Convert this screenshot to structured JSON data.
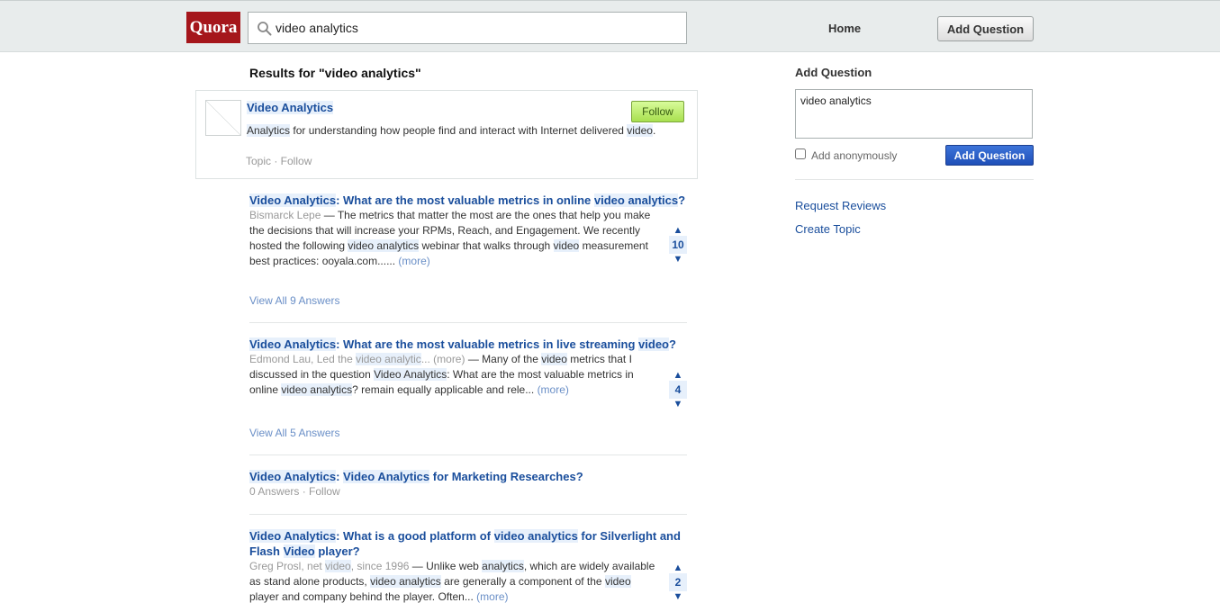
{
  "header": {
    "logo": "Quora",
    "search_value": "video analytics",
    "nav_home": "Home",
    "add_question_label": "Add Question"
  },
  "results": {
    "title": "Results for \"video analytics\""
  },
  "topic": {
    "title": "Video Analytics",
    "follow_label": "Follow",
    "desc_1": "Analytics",
    "desc_2": " for understanding how people find and interact with Internet delivered ",
    "desc_3": "video",
    "desc_4": ".",
    "meta": "Topic · Follow"
  },
  "questions": [
    {
      "title_hl": "Video Analytics",
      "title_rest_1": ": What are the most valuable metrics in online ",
      "title_hl_2": "video analytics",
      "title_rest_2": "?",
      "author": "Bismarck Lepe",
      "text_1": " — The metrics that matter the most are the ones that help you make the decisions that will increase your RPMs, Reach, and Engagement. We recently hosted the following ",
      "text_hl_1": "video analytics",
      "text_2": " webinar that walks through ",
      "text_hl_2": "video",
      "text_3": " measurement best practices: ooyala.com...... ",
      "more": "(more)",
      "votes": "10",
      "view_all": "View All 9 Answers"
    },
    {
      "title_hl": "Video Analytics",
      "title_rest_1": ": What are the most valuable metrics in live streaming ",
      "title_hl_2": "video",
      "title_rest_2": "?",
      "author": "Edmond Lau, Led the ",
      "author_hl": "video analytic",
      "author_tail": "... (more) ",
      "text_1": " — Many of the ",
      "text_hl_1": "video",
      "text_2": " metrics that I discussed in the question ",
      "text_hl_2": "Video Analytics",
      "text_3": ": What are the most valuable metrics in online ",
      "text_hl_3": "video analytics",
      "text_4": "? remain equally applicable and rele... ",
      "more": "(more)",
      "votes": "4",
      "view_all": "View All 5 Answers"
    },
    {
      "title_hl": "Video Analytics",
      "title_sep": ": ",
      "title_hl_2": "Video Analytics",
      "title_rest": " for Marketing Researches?",
      "meta": "0 Answers · Follow"
    },
    {
      "title_hl": "Video Analytics",
      "title_rest_1": ": What is a good platform of ",
      "title_hl_2": "video analytics",
      "title_rest_2": " for Silverlight and Flash ",
      "title_hl_3": "Video",
      "title_rest_3": " player?",
      "author": "Greg Prosl, net ",
      "author_hl": "video",
      "author_tail": ", since 1996",
      "text_1": " — Unlike web ",
      "text_hl_1": "analytics",
      "text_2": ", which are widely available as stand alone products, ",
      "text_hl_2": "video analytics",
      "text_3": " are generally a component of the ",
      "text_hl_3": "video",
      "text_4": " player and company behind the player. Often... ",
      "more": "(more)",
      "votes": "2"
    }
  ],
  "sidebar": {
    "title": "Add Question",
    "textarea_value": "video analytics",
    "anon_label": "Add anonymously",
    "add_button": "Add Question",
    "link_reviews": "Request Reviews",
    "link_topic": "Create Topic"
  },
  "colors": {
    "brand": "#a5161b",
    "link": "#1a4e9c",
    "highlight": "#e7f0fb",
    "follow_green": "#a8e04f",
    "primary_button": "#1f4fb8"
  }
}
